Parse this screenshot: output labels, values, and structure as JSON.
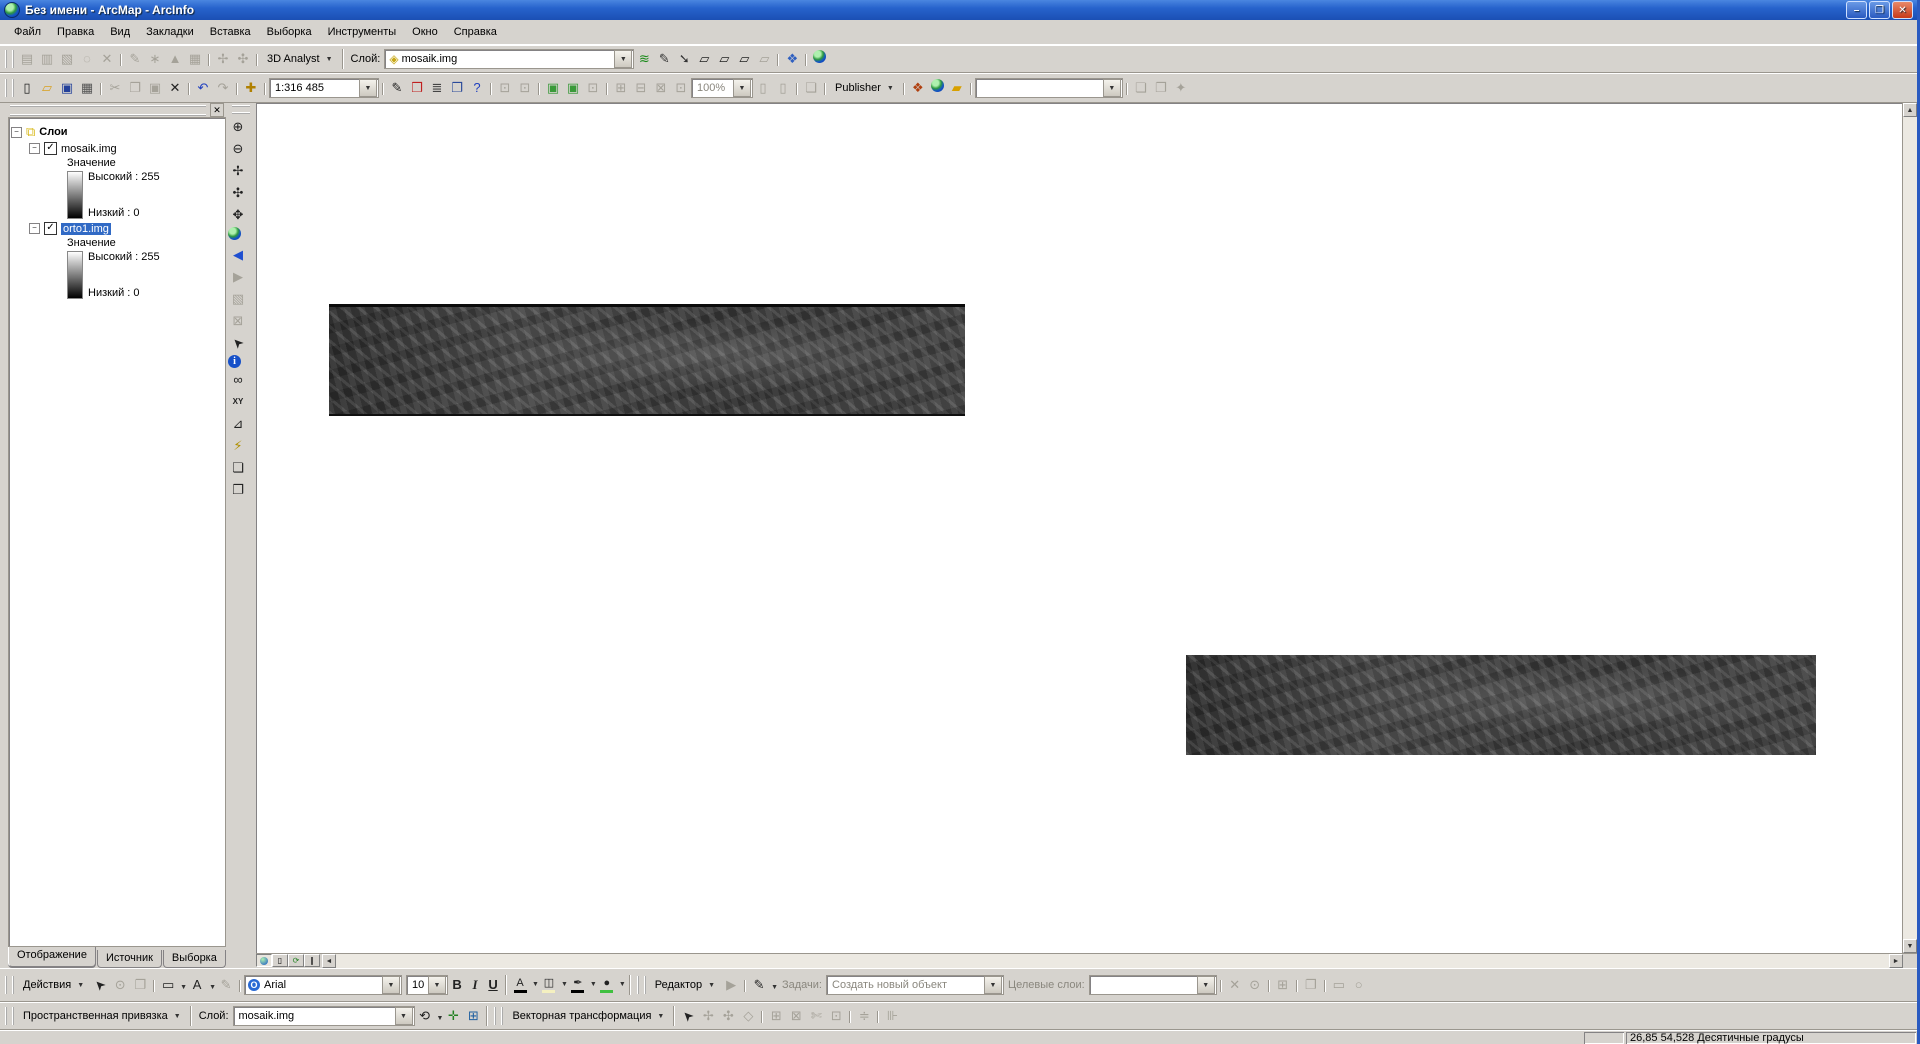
{
  "window": {
    "title": "Без имени - ArcMap - ArcInfo",
    "controls": {
      "minimize": "–",
      "maximize": "❐",
      "close": "✕"
    }
  },
  "menu": {
    "items": [
      "Файл",
      "Правка",
      "Вид",
      "Закладки",
      "Вставка",
      "Выборка",
      "Инструменты",
      "Окно",
      "Справка"
    ]
  },
  "colors": {
    "titlebar": "#2763cc",
    "selection": "#316ac5",
    "close_button": "#c83a1a"
  },
  "toolbar_3d": {
    "left_icons": [
      {
        "n": "attributes-table",
        "g": "▤",
        "d": 1
      },
      {
        "n": "attributes-table-2",
        "g": "▥",
        "d": 1
      },
      {
        "n": "sketch-tool",
        "g": "▧",
        "d": 1
      },
      {
        "n": "circle-select-tool",
        "g": "◌",
        "d": 1
      },
      {
        "n": "erase-tool",
        "g": "✕",
        "d": 1
      },
      {
        "sep": 1
      },
      {
        "n": "magic-wand-tool",
        "g": "✎",
        "d": 1
      },
      {
        "n": "update-tool",
        "g": "∗",
        "d": 1
      },
      {
        "n": "tin-surface-tool",
        "g": "▲",
        "d": 1
      },
      {
        "n": "raster-grid-tool",
        "g": "▦",
        "d": 1
      },
      {
        "sep": 1
      },
      {
        "n": "link-tool-1",
        "g": "✢",
        "d": 1
      },
      {
        "n": "link-tool-2",
        "g": "✣",
        "d": 1
      },
      {
        "sep": 1
      }
    ],
    "dropdown_label": "3D Analyst",
    "layer_label": "Слой:",
    "layer_value": "mosaik.img",
    "right_icons": [
      {
        "n": "create-contours",
        "g": "≋",
        "c": "#1a8a1a"
      },
      {
        "n": "interpolate-line",
        "g": "✎",
        "c": "#333"
      },
      {
        "n": "steepest-path",
        "g": "➘",
        "c": "#333"
      },
      {
        "n": "interpolate-polygon-1",
        "g": "▱"
      },
      {
        "n": "interpolate-polygon-2",
        "g": "▱"
      },
      {
        "n": "interpolate-polygon-3",
        "g": "▱"
      },
      {
        "n": "line-of-sight",
        "g": "▱",
        "d": 1
      },
      {
        "sep": 1
      },
      {
        "n": "launch-arcscene",
        "g": "❖",
        "c": "#3060c0"
      },
      {
        "sep": 1
      },
      {
        "n": "launch-arcglobe",
        "g": "",
        "cls": "globe"
      }
    ]
  },
  "toolbar_standard": {
    "icons_a": [
      {
        "n": "new-document",
        "g": "▯"
      },
      {
        "n": "open-document",
        "g": "▱",
        "c": "#d8a020"
      },
      {
        "n": "save-document",
        "g": "▣",
        "c": "#23409a"
      },
      {
        "n": "print",
        "g": "▦",
        "c": "#555"
      },
      {
        "sep": 1
      },
      {
        "n": "cut",
        "g": "✂",
        "d": 1
      },
      {
        "n": "copy",
        "g": "❐",
        "d": 1
      },
      {
        "n": "paste",
        "g": "▣",
        "d": 1
      },
      {
        "n": "delete",
        "g": "✕"
      },
      {
        "sep": 1
      },
      {
        "n": "undo",
        "g": "↶",
        "c": "#2040c0"
      },
      {
        "n": "redo",
        "g": "↷",
        "d": 1
      },
      {
        "sep": 1
      },
      {
        "n": "add-data",
        "g": "✚",
        "c": "#b08000"
      },
      {
        "sep": 1
      }
    ],
    "scale_value": "1:316 485",
    "icons_b": [
      {
        "sep": 1
      },
      {
        "n": "editor-toolbar-toggle",
        "g": "✎"
      },
      {
        "n": "arctoolbox",
        "g": "❒",
        "c": "#c02020"
      },
      {
        "n": "command-line",
        "g": "≣",
        "c": "#444"
      },
      {
        "n": "show-window",
        "g": "❐",
        "c": "#2a4a9a"
      },
      {
        "n": "help-whats-this",
        "g": "?",
        "c": "#2040c0"
      },
      {
        "sep": 1
      },
      {
        "n": "georef-viewer-1",
        "g": "⊡",
        "d": 1
      },
      {
        "n": "georef-viewer-2",
        "g": "⊡",
        "d": 1
      },
      {
        "sep": 1
      },
      {
        "n": "zoom-selected",
        "g": "▣",
        "c": "#3a9a3a"
      },
      {
        "n": "zoom-all",
        "g": "▣",
        "c": "#3a9a3a"
      },
      {
        "n": "pan-page",
        "g": "⊡",
        "d": 1
      },
      {
        "sep": 1
      },
      {
        "n": "layout-zoom-in",
        "g": "⊞",
        "d": 1
      },
      {
        "n": "layout-zoom-out",
        "g": "⊟",
        "d": 1
      },
      {
        "n": "layout-whole-page",
        "g": "⊠",
        "d": 1
      },
      {
        "n": "layout-100",
        "g": "⊡",
        "d": 1
      }
    ],
    "zoom_value": "100%",
    "icons_c": [
      {
        "n": "page-back",
        "g": "▯",
        "d": 1
      },
      {
        "n": "page-forward",
        "g": "▯",
        "d": 1
      },
      {
        "sep": 1
      },
      {
        "n": "zoom-window",
        "g": "❏",
        "d": 1
      },
      {
        "sep": 1
      }
    ],
    "publisher_label": "Publisher",
    "icons_d": [
      {
        "sep": 1
      },
      {
        "n": "style-palette",
        "g": "❖",
        "c": "#b04010"
      },
      {
        "n": "arcglobe-preview",
        "g": "",
        "cls": "globe"
      },
      {
        "n": "catalog",
        "g": "▰",
        "c": "#d8a000"
      },
      {
        "sep": 1
      }
    ],
    "blank_combo_value": "",
    "icons_e": [
      {
        "sep": 1
      },
      {
        "n": "extension-1",
        "g": "❏",
        "d": 1
      },
      {
        "n": "extension-2",
        "g": "❐",
        "d": 1
      },
      {
        "n": "extension-3",
        "g": "✦",
        "d": 1
      }
    ]
  },
  "tools_vertical": {
    "icons": [
      {
        "n": "zoom-in",
        "g": "⊕"
      },
      {
        "n": "zoom-out",
        "g": "⊖"
      },
      {
        "n": "fixed-zoom-in",
        "g": "✢"
      },
      {
        "n": "fixed-zoom-out",
        "g": "✣"
      },
      {
        "n": "pan",
        "g": "✥"
      },
      {
        "n": "full-extent",
        "g": "",
        "cls": "globe"
      },
      {
        "n": "go-back-extent",
        "g": "◀",
        "c": "#1f4fd0"
      },
      {
        "n": "go-forward-extent",
        "g": "▶",
        "d": 1
      },
      {
        "n": "select-features",
        "g": "▧",
        "d": 1
      },
      {
        "n": "clear-selection",
        "g": "⊠",
        "d": 1
      },
      {
        "n": "select-elements",
        "g": "➤",
        "rot": -135
      },
      {
        "n": "identify",
        "g": "i",
        "cls": "badge"
      },
      {
        "n": "find",
        "g": "∞"
      },
      {
        "n": "go-to-xy",
        "g": "XY",
        "cls": "tiny"
      },
      {
        "n": "measure",
        "g": "⊿"
      },
      {
        "n": "hyperlink",
        "g": "⚡",
        "c": "#b09000"
      },
      {
        "n": "html-popup",
        "g": "❏"
      },
      {
        "n": "overview-window",
        "g": "❐"
      }
    ]
  },
  "toc": {
    "close_glyph": "✕",
    "root_label": "Слои",
    "layers": [
      {
        "name": "mosaik.img",
        "field": "Значение",
        "high": "Высокий : 255",
        "low": "Низкий : 0"
      },
      {
        "name": "orto1.img",
        "field": "Значение",
        "high": "Высокий : 255",
        "low": "Низкий : 0"
      }
    ],
    "tabs": [
      "Отображение",
      "Источник",
      "Выборка"
    ],
    "active_tab": "Отображение"
  },
  "view_buttons": {
    "icons": [
      {
        "n": "data-view-button",
        "g": "",
        "cls": "mini-globe",
        "active": 1
      },
      {
        "n": "layout-view-button",
        "g": "▯"
      },
      {
        "n": "refresh-view-button",
        "g": "⟳",
        "c": "#208020"
      },
      {
        "n": "pause-drawing-button",
        "g": "∥"
      }
    ]
  },
  "draw_toolbar": {
    "actions_label": "Действия",
    "icons_a": [
      {
        "n": "select-elements-tool",
        "g": "➤",
        "rot": -135
      },
      {
        "n": "rotate-element",
        "g": "⊙",
        "d": 1
      },
      {
        "n": "zoom-to-element",
        "g": "❐",
        "d": 1
      },
      {
        "sep": 1
      },
      {
        "n": "shape-tool",
        "g": "▭",
        "dd": 1
      },
      {
        "n": "text-tool",
        "g": "A",
        "dd": 1
      },
      {
        "n": "edit-vertices",
        "g": "✎",
        "d": 1
      },
      {
        "sep": 1
      }
    ],
    "font_value": "Arial",
    "size_value": "10",
    "bold_label": "B",
    "italic_label": "I",
    "underline_label": "U",
    "color_buttons": [
      {
        "n": "font-color",
        "g": "A",
        "bar": "#000000",
        "dd": 1
      },
      {
        "n": "fill-color",
        "g": "◫",
        "bar": "#f4f0c0",
        "dd": 1
      },
      {
        "n": "line-color",
        "g": "✒",
        "bar": "#000000",
        "dd": 1
      },
      {
        "n": "marker-color",
        "g": "●",
        "bar": "#40c040",
        "dd": 1
      }
    ]
  },
  "editor_toolbar": {
    "label": "Редактор",
    "icons_a": [
      {
        "n": "edit-tool-arrow",
        "g": "▶",
        "d": 1
      },
      {
        "sep": 1
      },
      {
        "n": "sketch-tool-pencil",
        "g": "✎",
        "dd": 1
      }
    ],
    "tasks_label": "Задачи:",
    "task_value": "Создать новый объект",
    "targets_label": "Целевые слои:",
    "target_value": "",
    "icons_b": [
      {
        "sep": 1
      },
      {
        "n": "split-tool",
        "g": "✕",
        "d": 1
      },
      {
        "n": "rotate-tool",
        "g": "⊙",
        "d": 1
      },
      {
        "sep": 1
      },
      {
        "n": "attributes-window",
        "g": "⊞",
        "d": 1
      },
      {
        "sep": 1
      },
      {
        "n": "sketch-properties",
        "g": "❐",
        "d": 1
      },
      {
        "sep": 1
      },
      {
        "n": "create-rectangle",
        "g": "▭",
        "d": 1
      },
      {
        "n": "create-circle",
        "g": "○",
        "d": 1
      }
    ]
  },
  "georef_toolbar": {
    "label": "Пространственная привязка",
    "layer_label": "Слой:",
    "layer_value": "mosaik.img",
    "icons": [
      {
        "n": "rotate-image",
        "g": "⟲",
        "dd": 1
      },
      {
        "n": "add-control-points",
        "g": "✛",
        "c": "#208020"
      },
      {
        "n": "view-link-table",
        "g": "⊞",
        "c": "#2060a0"
      }
    ]
  },
  "adjust_toolbar": {
    "label": "Векторная трансформация",
    "icons": [
      {
        "n": "adjust-pointer",
        "g": "➤",
        "rot": -135
      },
      {
        "n": "new-displacement-link",
        "g": "✢",
        "d": 1
      },
      {
        "n": "modify-link",
        "g": "✣",
        "d": 1
      },
      {
        "n": "preview-window",
        "g": "◇",
        "d": 1
      },
      {
        "sep": 1
      },
      {
        "n": "edge-match",
        "g": "⊞",
        "d": 1
      },
      {
        "n": "rubbersheet",
        "g": "⊠",
        "d": 1
      },
      {
        "n": "split-link",
        "g": "✄",
        "d": 1
      },
      {
        "n": "link-attributes",
        "g": "⊡",
        "d": 1
      },
      {
        "sep": 1
      },
      {
        "n": "adjust-options",
        "g": "≑",
        "d": 1
      },
      {
        "sep": 1
      },
      {
        "n": "adjust-extra",
        "g": "⊪",
        "d": 1
      }
    ]
  },
  "statusbar": {
    "coords": "26,85  54,528 Десятичные градусы"
  }
}
